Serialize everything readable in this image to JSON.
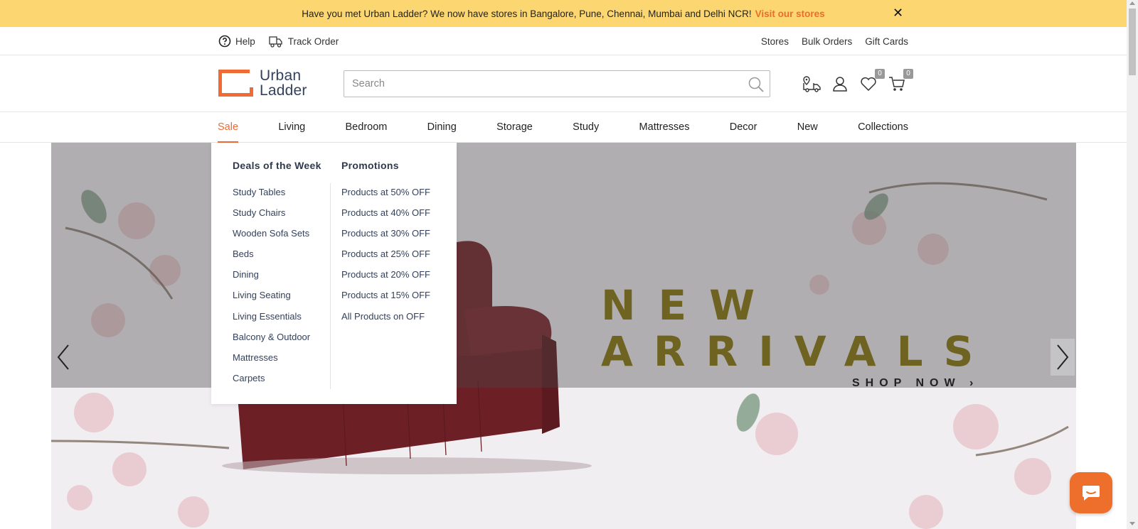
{
  "promo": {
    "message": "Have you met Urban Ladder? We now have stores in Bangalore, Pune, Chennai, Mumbai and Delhi NCR!",
    "link_label": "Visit our stores",
    "close_glyph": "✕"
  },
  "utility_bar": {
    "left": [
      {
        "label": "Help",
        "icon": "help-circle-icon"
      },
      {
        "label": "Track Order",
        "icon": "truck-icon"
      }
    ],
    "right": [
      "Stores",
      "Bulk Orders",
      "Gift Cards"
    ]
  },
  "header": {
    "logo_line1": "Urban",
    "logo_line2": "Ladder",
    "search_placeholder": "Search",
    "wishlist_count": "0",
    "cart_count": "0",
    "icons": [
      "store-locator-icon",
      "user-icon",
      "wishlist-heart-icon",
      "cart-icon"
    ]
  },
  "nav": {
    "items": [
      "Sale",
      "Living",
      "Bedroom",
      "Dining",
      "Storage",
      "Study",
      "Mattresses",
      "Decor",
      "New",
      "Collections"
    ],
    "active": "Sale"
  },
  "mega_menu": {
    "col1": {
      "title": "Deals of the Week",
      "items": [
        "Study Tables",
        "Study Chairs",
        "Wooden Sofa Sets",
        "Beds",
        "Dining",
        "Living Seating",
        "Living Essentials",
        "Balcony & Outdoor",
        "Mattresses",
        "Carpets"
      ]
    },
    "col2": {
      "title": "Promotions",
      "items": [
        "Products at 50% OFF",
        "Products at 40% OFF",
        "Products at 30% OFF",
        "Products at 25% OFF",
        "Products at 20% OFF",
        "Products at 15% OFF",
        "All Products on OFF"
      ]
    }
  },
  "hero": {
    "line1": "NEW",
    "line2": "ARRIVALS",
    "cta": "SHOP NOW ›"
  },
  "colors": {
    "accent": "#ef6b33",
    "promo_bg": "#fcd771",
    "hero_title": "#6e6320",
    "chat_button": "#ee6e2c"
  }
}
